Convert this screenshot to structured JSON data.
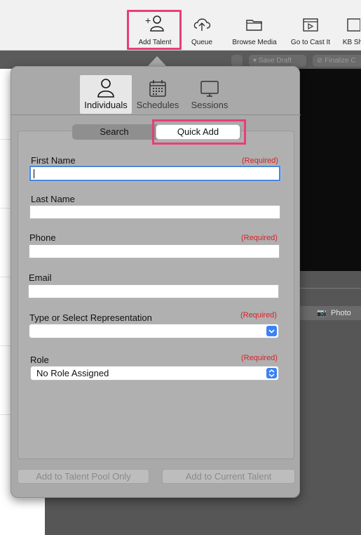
{
  "toolbar": {
    "items": [
      {
        "label": "Add Talent",
        "icon": "add-person-icon"
      },
      {
        "label": "Queue",
        "icon": "cloud-upload-icon"
      },
      {
        "label": "Browse Media",
        "icon": "folder-icon"
      },
      {
        "label": "Go to Cast It",
        "icon": "clapper-icon"
      },
      {
        "label": "KB Sh",
        "icon": "kb-icon"
      }
    ],
    "save_draft": "Save Draft",
    "finalize": "Finalize C"
  },
  "popover": {
    "tabs": [
      {
        "label": "Individuals",
        "icon": "person-icon",
        "active": true
      },
      {
        "label": "Schedules",
        "icon": "calendar-icon",
        "active": false
      },
      {
        "label": "Sessions",
        "icon": "monitor-icon",
        "active": false
      }
    ],
    "segment": {
      "search": "Search",
      "quick_add": "Quick Add",
      "selected": "Quick Add"
    },
    "form": {
      "first_name": {
        "label": "First Name",
        "required": "(Required)",
        "value": ""
      },
      "last_name": {
        "label": "Last Name",
        "value": ""
      },
      "phone": {
        "label": "Phone",
        "required": "(Required)",
        "value": ""
      },
      "email": {
        "label": "Email",
        "value": ""
      },
      "representation": {
        "label": "Type or Select Representation",
        "required": "(Required)",
        "value": ""
      },
      "role": {
        "label": "Role",
        "required": "(Required)",
        "value": "No Role Assigned"
      }
    },
    "buttons": {
      "pool": "Add to Talent Pool Only",
      "current": "Add to Current Talent"
    }
  },
  "background": {
    "photo_label": "Photo"
  },
  "colors": {
    "highlight": "#e83e79",
    "required": "#d8222a",
    "focus": "#4b84d7",
    "select_button": "#3b82f6"
  }
}
